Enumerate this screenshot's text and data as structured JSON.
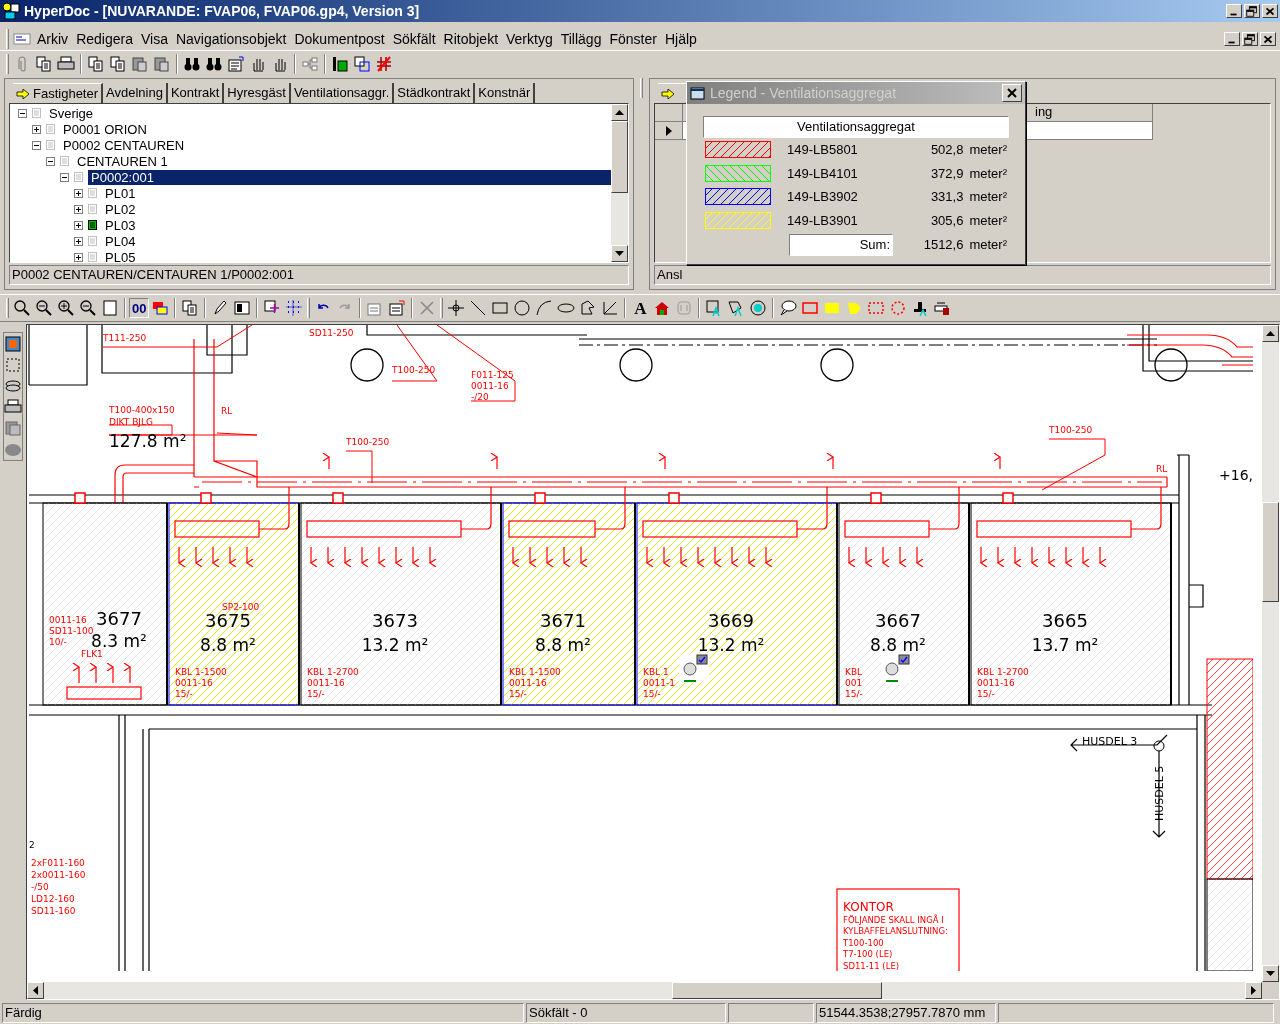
{
  "window": {
    "title": "HyperDoc - [NUVARANDE: FVAP06, FVAP06.gp4, Version 3]"
  },
  "menu": [
    "Arkiv",
    "Redigera",
    "Visa",
    "Navigationsobjekt",
    "Dokumentpost",
    "Sökfält",
    "Ritobjekt",
    "Verktyg",
    "Tillägg",
    "Fönster",
    "Hjälp"
  ],
  "tabs": [
    {
      "label": "Fastigheter",
      "selected": true
    },
    {
      "label": "Avdelning",
      "selected": false
    },
    {
      "label": "Kontrakt",
      "selected": false
    },
    {
      "label": "Hyresgäst",
      "selected": false
    },
    {
      "label": "Ventilationsaggr.",
      "selected": false
    },
    {
      "label": "Städkontrakt",
      "selected": false
    },
    {
      "label": "Konstnär",
      "selected": false
    }
  ],
  "tree": [
    {
      "label": "Sverige",
      "expanded": true,
      "selected": false,
      "children": [
        {
          "label": "P0001 ORION",
          "expanded": false,
          "selected": false
        },
        {
          "label": "P0002 CENTAUREN",
          "expanded": true,
          "selected": false,
          "children": [
            {
              "label": "CENTAUREN 1",
              "expanded": true,
              "selected": false,
              "children": [
                {
                  "label": "P0002:001",
                  "expanded": true,
                  "selected": true,
                  "children": [
                    {
                      "label": "PL01",
                      "expanded": false,
                      "selected": false,
                      "flagged": false
                    },
                    {
                      "label": "PL02",
                      "expanded": false,
                      "selected": false,
                      "flagged": false
                    },
                    {
                      "label": "PL03",
                      "expanded": false,
                      "selected": false,
                      "flagged": true
                    },
                    {
                      "label": "PL04",
                      "expanded": false,
                      "selected": false,
                      "flagged": false
                    },
                    {
                      "label": "PL05",
                      "expanded": false,
                      "selected": false,
                      "flagged": false
                    }
                  ]
                }
              ]
            }
          ]
        }
      ]
    }
  ],
  "tree_path": "P0002 CENTAUREN/CENTAUREN 1/P0002:001",
  "right_panel": {
    "column_header": "ing",
    "footer": "Ansl"
  },
  "legend": {
    "title": "Legend - Ventilationsaggregat",
    "heading": "Ventilationsaggregat",
    "entries": [
      {
        "name": "149-LB5801",
        "area": "502,8",
        "unit": "meter²",
        "color": "#ff0000",
        "kind": "forward"
      },
      {
        "name": "149-LB4101",
        "area": "372,9",
        "unit": "meter²",
        "color": "#00ff00",
        "kind": "backward"
      },
      {
        "name": "149-LB3902",
        "area": "331,3",
        "unit": "meter²",
        "color": "#0000ff",
        "kind": "forward"
      },
      {
        "name": "149-LB3901",
        "area": "305,6",
        "unit": "meter²",
        "color": "#ffff00",
        "kind": "forward"
      }
    ],
    "sum_label": "Sum:",
    "sum": "1512,6",
    "sum_unit": "meter²"
  },
  "draw_toolbar_text_buttons": [
    "00",
    "A"
  ],
  "drawing": {
    "rooms": [
      {
        "number": "3677",
        "area": "8.3 m²",
        "highlighted": false,
        "has_icon": false,
        "notes": [
          "0011-16",
          "SD11-100",
          "10/-",
          "FLK1"
        ]
      },
      {
        "number": "3675",
        "area": "8.8 m²",
        "highlighted": true,
        "has_icon": false,
        "notes": [
          "KBL 1-1500",
          "0011-16",
          "15/-"
        ]
      },
      {
        "number": "3673",
        "area": "13.2 m²",
        "highlighted": false,
        "has_icon": false,
        "notes": [
          "KBL 1-2700",
          "0011-16",
          "15/-"
        ]
      },
      {
        "number": "3671",
        "area": "8.8 m²",
        "highlighted": true,
        "has_icon": false,
        "notes": [
          "KBL 1-1500",
          "0011-16",
          "15/-"
        ]
      },
      {
        "number": "3669",
        "area": "13.2 m²",
        "highlighted": true,
        "has_icon": true,
        "notes": [
          "KBL 1",
          "0011-1",
          "15/-"
        ]
      },
      {
        "number": "3667",
        "area": "8.8 m²",
        "highlighted": false,
        "has_icon": true,
        "notes": [
          "KBL",
          "001",
          "15/-"
        ]
      },
      {
        "number": "3665",
        "area": "13.7 m²",
        "highlighted": false,
        "has_icon": false,
        "notes": [
          "KBL 1-2700",
          "0011-16",
          "15/-"
        ]
      }
    ],
    "labels": [
      {
        "text": "T111-250",
        "kind": "red"
      },
      {
        "text": "SD11-250",
        "kind": "red"
      },
      {
        "text": "T100-250",
        "kind": "red"
      },
      {
        "text": "F011-125",
        "kind": "red"
      },
      {
        "text": "0011-16",
        "kind": "red"
      },
      {
        "text": "-/20",
        "kind": "red"
      },
      {
        "text": "T100-400x150",
        "kind": "red"
      },
      {
        "text": "DIKT BJLG",
        "kind": "red"
      },
      {
        "text": "127.8 m²",
        "kind": "black"
      },
      {
        "text": "RL",
        "kind": "red"
      },
      {
        "text": "T100-250",
        "kind": "red"
      },
      {
        "text": "T100-250",
        "kind": "red"
      },
      {
        "text": "RL",
        "kind": "red"
      },
      {
        "text": "+16,",
        "kind": "black"
      },
      {
        "text": "SP2-100",
        "kind": "red"
      },
      {
        "text": "2",
        "kind": "black"
      },
      {
        "text": "2xF011-160",
        "kind": "red"
      },
      {
        "text": "2x0011-160",
        "kind": "red"
      },
      {
        "text": "-/50",
        "kind": "red"
      },
      {
        "text": "LD12-160",
        "kind": "red"
      },
      {
        "text": "SD11-160",
        "kind": "red"
      },
      {
        "text": "HUSDEL 3",
        "kind": "black"
      },
      {
        "text": "HUSDEL 5",
        "kind": "black"
      }
    ],
    "note": [
      "KONTOR",
      "FÖLJANDE SKALL INGÅ I",
      "KYLBAFFELANSLUTNING:",
      "T100-100",
      "T7-100 (LE)",
      "SD11-11 (LE)"
    ]
  },
  "status_bar": [
    "Färdig",
    "Sökfält - 0",
    "51544.3538;27957.7870 mm"
  ]
}
